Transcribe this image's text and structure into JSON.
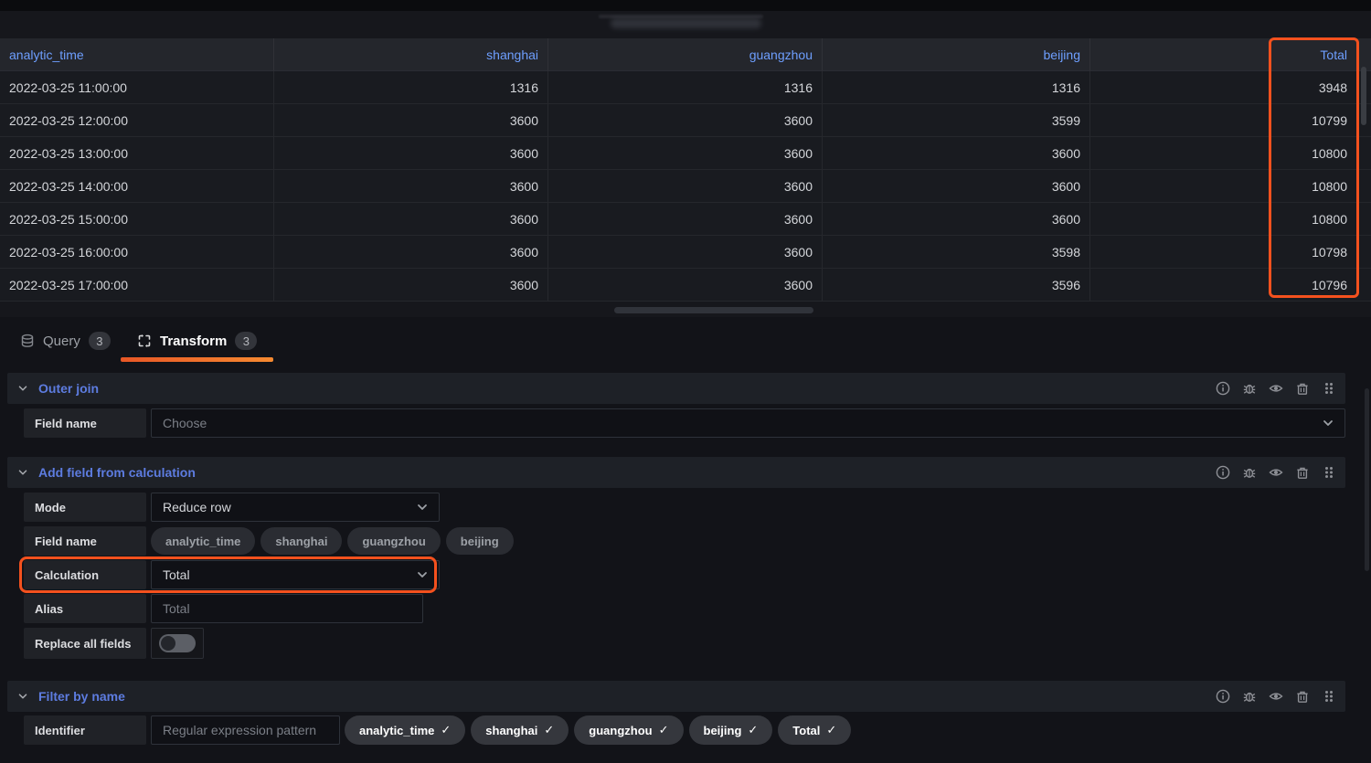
{
  "panel": {
    "table": {
      "columns": [
        "analytic_time",
        "shanghai",
        "guangzhou",
        "beijing",
        "Total"
      ],
      "rows": [
        [
          "2022-03-25 11:00:00",
          "1316",
          "1316",
          "1316",
          "3948"
        ],
        [
          "2022-03-25 12:00:00",
          "3600",
          "3600",
          "3599",
          "10799"
        ],
        [
          "2022-03-25 13:00:00",
          "3600",
          "3600",
          "3600",
          "10800"
        ],
        [
          "2022-03-25 14:00:00",
          "3600",
          "3600",
          "3600",
          "10800"
        ],
        [
          "2022-03-25 15:00:00",
          "3600",
          "3600",
          "3600",
          "10800"
        ],
        [
          "2022-03-25 16:00:00",
          "3600",
          "3600",
          "3598",
          "10798"
        ],
        [
          "2022-03-25 17:00:00",
          "3600",
          "3600",
          "3596",
          "10796"
        ]
      ]
    }
  },
  "tabs": {
    "query": {
      "label": "Query",
      "badge": "3"
    },
    "transform": {
      "label": "Transform",
      "badge": "3"
    }
  },
  "sections": {
    "outer_join": {
      "title": "Outer join",
      "field_name_label": "Field name",
      "field_name_placeholder": "Choose"
    },
    "add_field": {
      "title": "Add field from calculation",
      "mode_label": "Mode",
      "mode_value": "Reduce row",
      "field_name_label": "Field name",
      "field_chips": [
        "analytic_time",
        "shanghai",
        "guangzhou",
        "beijing"
      ],
      "calculation_label": "Calculation",
      "calculation_value": "Total",
      "alias_label": "Alias",
      "alias_placeholder": "Total",
      "replace_label": "Replace all fields",
      "replace_value": "off"
    },
    "filter_by_name": {
      "title": "Filter by name",
      "identifier_label": "Identifier",
      "identifier_placeholder": "Regular expression pattern",
      "selected_chips": [
        "analytic_time",
        "shanghai",
        "guangzhou",
        "beijing",
        "Total"
      ]
    }
  },
  "icons": {
    "check": "✓"
  },
  "colors": {
    "annotation_orange": "#f4511e",
    "link_blue": "#6e9fff",
    "section_title_blue": "#5d7ce0",
    "tab_underline_gradient_start": "#e85726",
    "tab_underline_gradient_end": "#f68a31",
    "table_header_bg": "#24262c",
    "table_row_bg": "#191b20",
    "page_bg": "#121318"
  }
}
